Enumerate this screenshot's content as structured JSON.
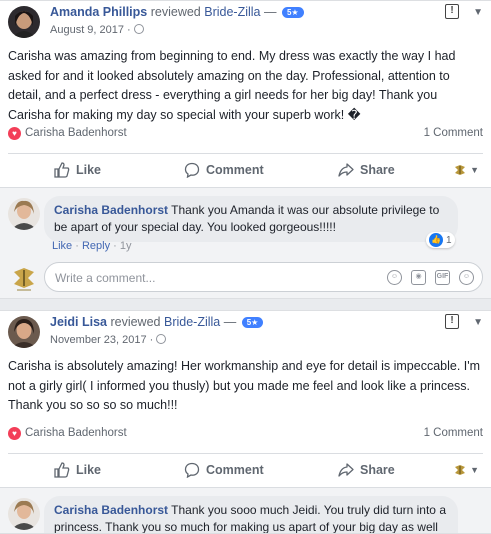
{
  "posts": [
    {
      "author": "Amanda Phillips",
      "action": "reviewed",
      "page": "Bride-Zilla",
      "separator": "—",
      "rating": "5★",
      "date": "August 9, 2017 ·",
      "text": "Carisha was amazing from beginning to end. My dress was exactly the way I had asked for and it looked absolutely amazing on the day. Professional, attention to detail, and a perfect dress - everything a girl needs for her big day! Thank you Carisha for making my day so special with your superb work! �",
      "reaction_name": "Carisha Badenhorst",
      "comment_count": "1 Comment",
      "reply": {
        "author": "Carisha Badenhorst",
        "text": "Thank you Amanda it was our absolute privilege to be apart of your special day. You looked gorgeous!!!!!",
        "like": "Like",
        "dot1": " · ",
        "reply": "Reply",
        "dot2": " · ",
        "time": "1y",
        "likes": "1"
      },
      "write_placeholder": "Write a comment..."
    },
    {
      "author": "Jeidi Lisa",
      "action": "reviewed",
      "page": "Bride-Zilla",
      "separator": "—",
      "rating": "5★",
      "date": "November 23, 2017 ·",
      "text": "Carisha is absolutely amazing! Her workmanship and eye for detail is impeccable. I'm not a girly girl( I informed you thusly) but you made me feel and look like a princess. Thank you so so so so much!!!",
      "reaction_name": "Carisha Badenhorst",
      "comment_count": "1 Comment",
      "reply": {
        "author": "Carisha Badenhorst",
        "text": "Thank you sooo much Jeidi. You truly did turn into a princess. Thank you so much for making us apart of your big day as well as"
      }
    }
  ],
  "actions": {
    "like": "Like",
    "comment": "Comment",
    "share": "Share"
  },
  "colors": {
    "link": "#385898",
    "badge": "#4080ff",
    "heart": "#f33e58",
    "like_blue": "#1877f2"
  }
}
